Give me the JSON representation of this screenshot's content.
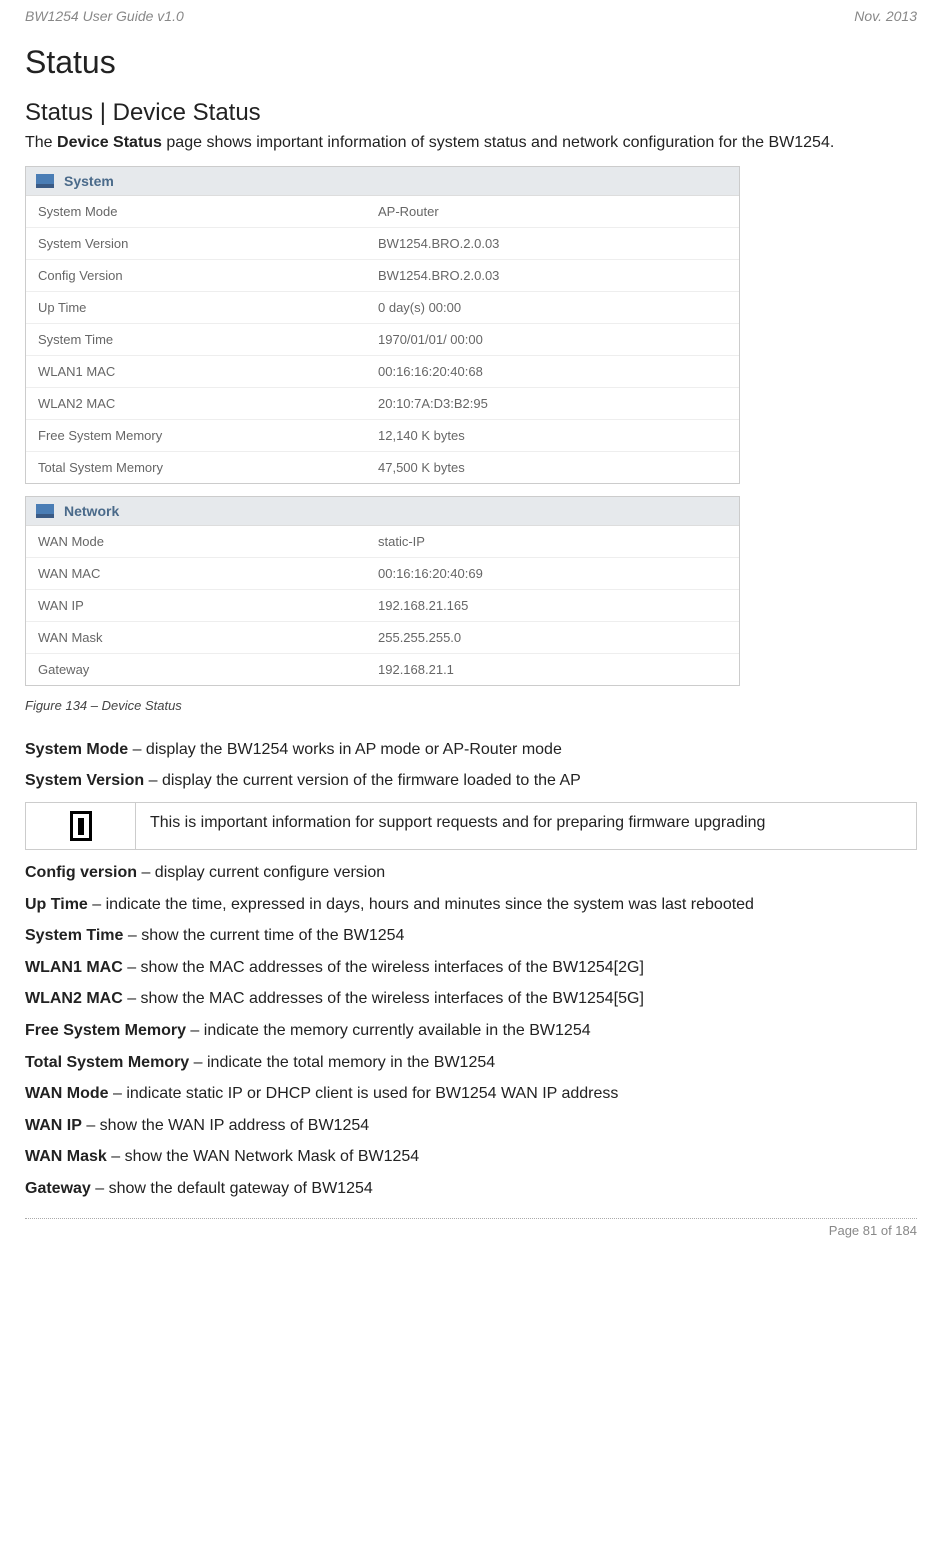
{
  "header": {
    "left": "BW1254 User Guide v1.0",
    "right": "Nov.  2013"
  },
  "h1": "Status",
  "h2": "Status | Device Status",
  "intro_prefix": "The ",
  "intro_bold": "Device Status",
  "intro_suffix": " page shows important information of system status and network configuration for the BW1254.",
  "system": {
    "title": "System",
    "rows": [
      {
        "label": "System Mode",
        "value": "AP-Router"
      },
      {
        "label": "System Version",
        "value": "BW1254.BRO.2.0.03"
      },
      {
        "label": "Config Version",
        "value": "BW1254.BRO.2.0.03"
      },
      {
        "label": "Up Time",
        "value": "0 day(s) 00:00"
      },
      {
        "label": "System Time",
        "value": "1970/01/01/ 00:00"
      },
      {
        "label": "WLAN1 MAC",
        "value": "00:16:16:20:40:68"
      },
      {
        "label": "WLAN2 MAC",
        "value": "20:10:7A:D3:B2:95"
      },
      {
        "label": "Free System Memory",
        "value": "12,140 K bytes"
      },
      {
        "label": "Total System Memory",
        "value": "47,500 K bytes"
      }
    ]
  },
  "network": {
    "title": "Network",
    "rows": [
      {
        "label": "WAN Mode",
        "value": "static-IP"
      },
      {
        "label": "WAN MAC",
        "value": "00:16:16:20:40:69"
      },
      {
        "label": "WAN IP",
        "value": "192.168.21.165"
      },
      {
        "label": "WAN Mask",
        "value": "255.255.255.0"
      },
      {
        "label": "Gateway",
        "value": "192.168.21.1"
      }
    ]
  },
  "figure_caption": "Figure 134  – Device Status",
  "descs": {
    "system_mode": {
      "bold": "System Mode",
      "text": " – display the BW1254 works in AP mode or AP-Router mode"
    },
    "system_version": {
      "bold": "System Version",
      "text": " – display the current version of the firmware loaded to the AP"
    },
    "config_version": {
      "bold": "Config version",
      "text": " – display current configure version"
    },
    "up_time": {
      "bold": "Up Time",
      "text": " – indicate the time, expressed in days, hours and minutes since the system was last rebooted"
    },
    "system_time": {
      "bold": "System Time",
      "text": " – show the current time of the BW1254"
    },
    "wlan1": {
      "bold": "WLAN1 MAC",
      "text": " – show the MAC addresses of the wireless interfaces of the BW1254[2G]"
    },
    "wlan2": {
      "bold": "WLAN2 MAC",
      "text": " – show the MAC addresses of the wireless interfaces of the BW1254[5G]"
    },
    "free_mem": {
      "bold": "Free System Memory",
      "text": " – indicate the memory currently available in the BW1254"
    },
    "total_mem": {
      "bold": "Total System Memory",
      "text": " – indicate the total memory in the BW1254"
    },
    "wan_mode": {
      "bold": "WAN Mode",
      "text": " – indicate static IP or DHCP client is used for BW1254 WAN IP address"
    },
    "wan_ip": {
      "bold": "WAN IP",
      "text": " – show the WAN IP address of BW1254"
    },
    "wan_mask": {
      "bold": "WAN Mask",
      "text": " – show the WAN Network Mask of BW1254"
    },
    "gateway": {
      "bold": "Gateway",
      "text": " – show the default gateway of BW1254"
    }
  },
  "info_note": "This is important information for support requests and for preparing firmware upgrading",
  "footer": "Page 81 of 184"
}
